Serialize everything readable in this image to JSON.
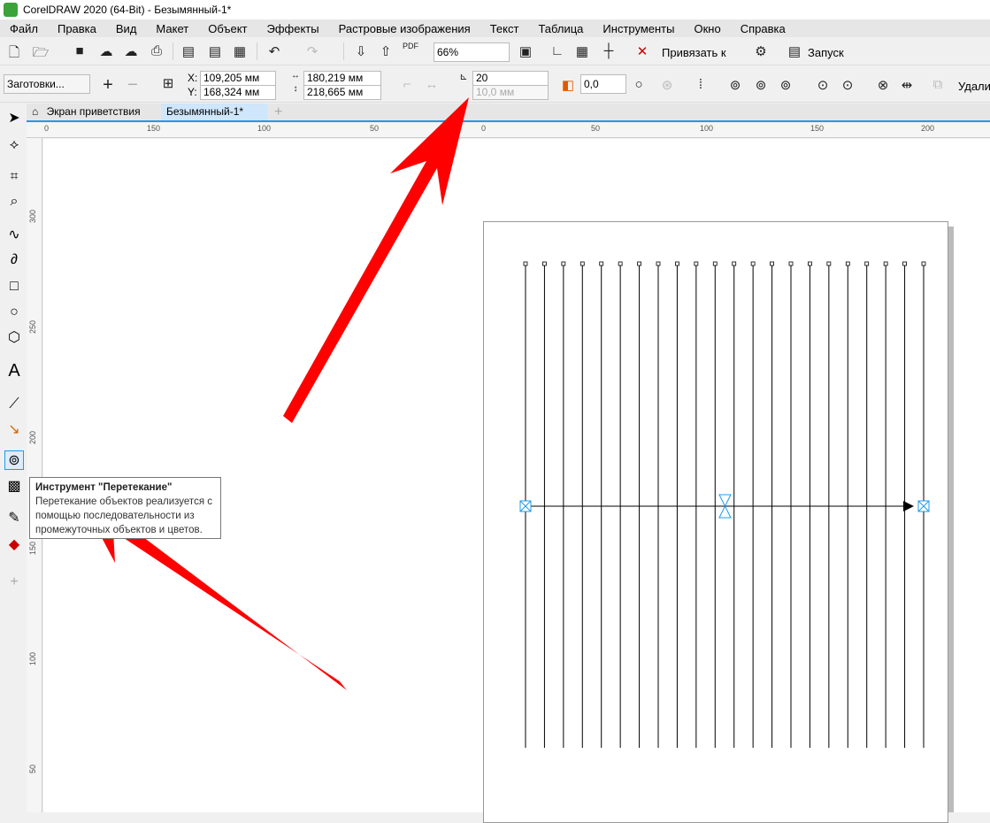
{
  "title": "CorelDRAW 2020 (64-Bit) - Безымянный-1*",
  "menu": [
    "Файл",
    "Правка",
    "Вид",
    "Макет",
    "Объект",
    "Эффекты",
    "Растровые изображения",
    "Текст",
    "Таблица",
    "Инструменты",
    "Окно",
    "Справка"
  ],
  "toolbar": {
    "zoom": "66%",
    "snap_label": "Привязать к",
    "launch_label": "Запуск"
  },
  "property_bar": {
    "presets": "Заготовки...",
    "x": "109,205 мм",
    "y": "168,324 мм",
    "x_label": "X:",
    "y_label": "Y:",
    "width": "180,219 мм",
    "height": "218,665 мм",
    "blend_steps": "20",
    "blend_spacing": "10,0 мм",
    "rotation": "0,0",
    "delete_label": "Удалит"
  },
  "tabs": {
    "welcome": "Экран приветствия",
    "document": "Безымянный-1*"
  },
  "hruler": [
    "0",
    "150",
    "100",
    "50",
    "0",
    "50",
    "100",
    "150",
    "200"
  ],
  "vruler": [
    "300",
    "250",
    "200",
    "150",
    "100",
    "50"
  ],
  "tooltip": {
    "title": "Инструмент \"Перетекание\"",
    "body_lines": [
      "Перетекание объектов реализуется с",
      "помощью последовательности из",
      "промежуточных объектов и цветов."
    ]
  },
  "blend": {
    "steps": 20
  },
  "colors": {
    "accent": "#1e9be9",
    "arrow": "#ff0000"
  }
}
